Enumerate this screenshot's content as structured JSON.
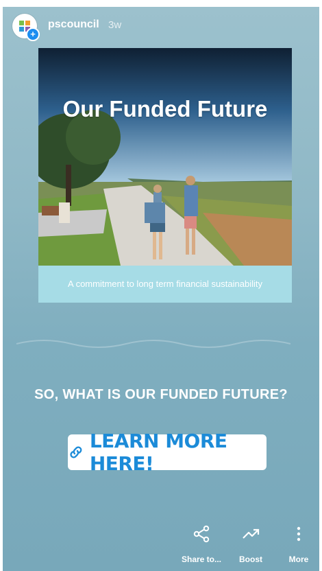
{
  "header": {
    "username": "pscouncil",
    "age": "3w"
  },
  "card": {
    "title": "Our Funded Future",
    "caption": "A commitment to long term financial sustainability"
  },
  "question": "SO, WHAT IS OUR FUNDED FUTURE?",
  "link_button": {
    "label": "LEARN MORE HERE!"
  },
  "actions": [
    {
      "label": "Share to...",
      "icon": "share-icon"
    },
    {
      "label": "Boost",
      "icon": "boost-icon"
    },
    {
      "label": "More",
      "icon": "more-icon"
    }
  ],
  "colors": {
    "background": "#8fb8c6",
    "accent": "#1c8bd8",
    "caption_band": "#a6dce6"
  }
}
